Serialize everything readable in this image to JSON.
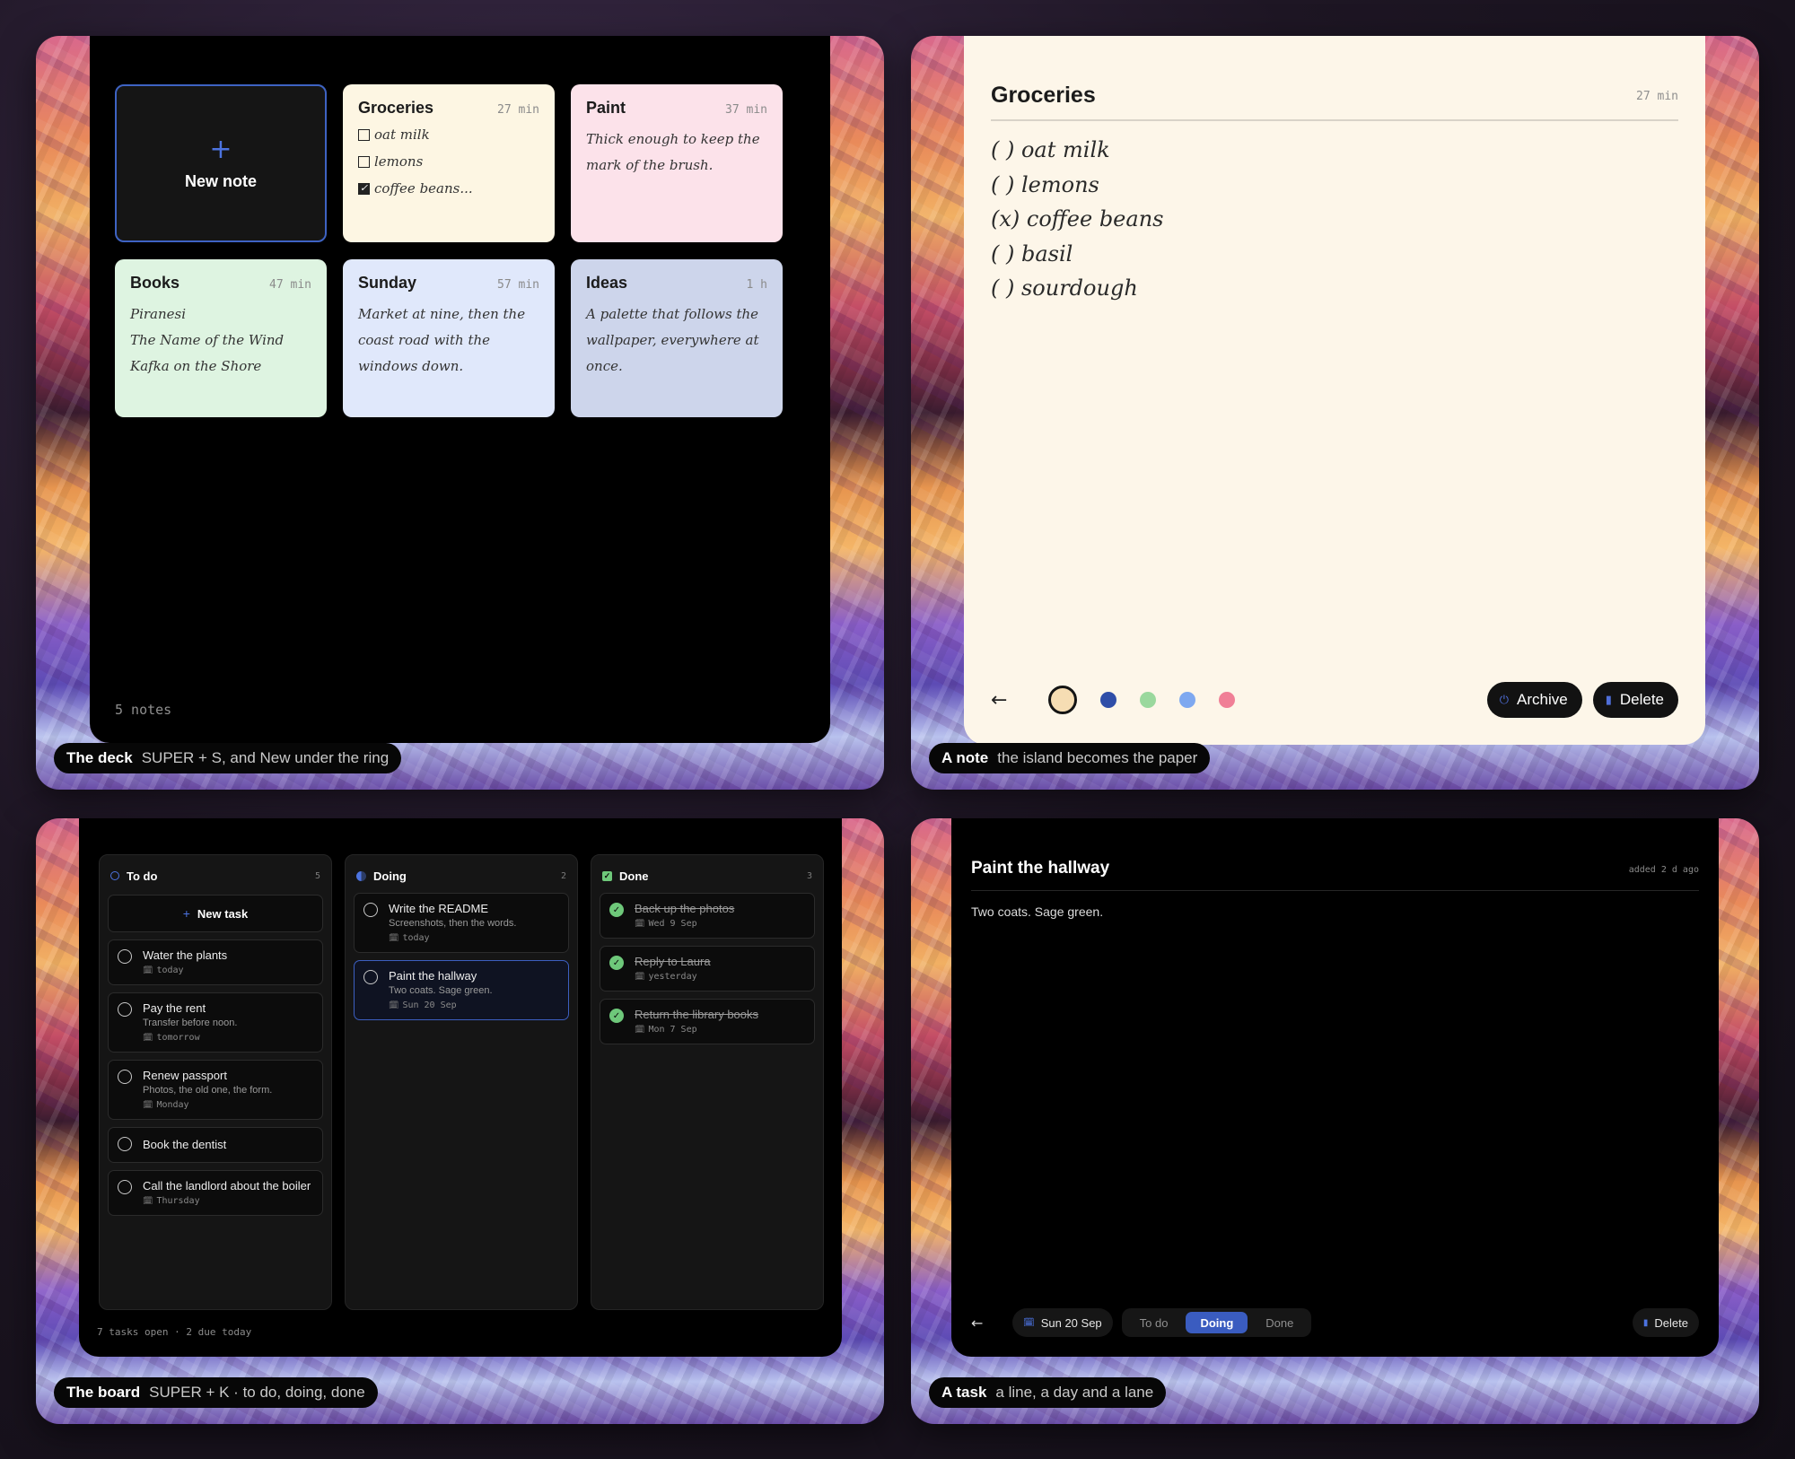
{
  "deck": {
    "caption_title": "The deck",
    "caption_text": "SUPER + S, and New under the ring",
    "new_note_icon": "+",
    "new_note_label": "New note",
    "count": "5 notes",
    "notes": {
      "groceries": {
        "title": "Groceries",
        "age": "27 min",
        "items": [
          {
            "text": "oat milk",
            "checked": false
          },
          {
            "text": "lemons",
            "checked": false
          },
          {
            "text": "coffee beans...",
            "checked": true
          }
        ],
        "color": "#fdf6e3"
      },
      "paint": {
        "title": "Paint",
        "age": "37 min",
        "lines": [
          "Thick enough to keep the",
          "mark of the brush."
        ],
        "color": "#fce2ea"
      },
      "books": {
        "title": "Books",
        "age": "47 min",
        "lines": [
          "Piranesi",
          "The Name of the Wind",
          "Kafka on the Shore"
        ],
        "color": "#def4e1"
      },
      "sunday": {
        "title": "Sunday",
        "age": "57 min",
        "lines": [
          "Market at nine, then the",
          "coast road with the",
          "windows down."
        ],
        "color": "#e0e8fb"
      },
      "ideas": {
        "title": "Ideas",
        "age": "1 h",
        "lines": [
          "A palette that follows the",
          "wallpaper, everywhere at",
          "once."
        ],
        "color": "#cdd5eb"
      }
    }
  },
  "note": {
    "caption_title": "A note",
    "caption_text": "the island becomes the paper",
    "title": "Groceries",
    "age": "27 min",
    "lines": [
      "( ) oat milk",
      "( ) lemons",
      "(x) coffee beans",
      "( ) basil",
      "( ) sourdough"
    ],
    "back_icon": "←",
    "swatches": [
      "#f6ddb3",
      "#2f4ea8",
      "#9ad89d",
      "#7ea8f0",
      "#f07f96"
    ],
    "archive_label": "Archive",
    "archive_icon": "⏻",
    "delete_label": "Delete",
    "delete_icon": "▮"
  },
  "board": {
    "caption_title": "The board",
    "caption_text": "SUPER + K · to do, doing, done",
    "footer": "7 tasks open · 2 due today",
    "new_task_label": "New task",
    "new_task_icon": "+",
    "calendar_icon": "🗓",
    "check_glyph": "✓",
    "columns": {
      "todo": {
        "title": "To do",
        "count": "5",
        "tasks": [
          {
            "title": "Water the plants",
            "due": "today"
          },
          {
            "title": "Pay the rent",
            "desc": "Transfer before noon.",
            "due": "tomorrow"
          },
          {
            "title": "Renew passport",
            "desc": "Photos, the old one, the form.",
            "due": "Monday"
          },
          {
            "title": "Book the dentist"
          },
          {
            "title": "Call the landlord about the boiler",
            "due": "Thursday"
          }
        ]
      },
      "doing": {
        "title": "Doing",
        "count": "2",
        "tasks": [
          {
            "title": "Write the README",
            "desc": "Screenshots, then the words.",
            "due": "today"
          },
          {
            "title": "Paint the hallway",
            "desc": "Two coats. Sage green.",
            "due": "Sun 20 Sep"
          }
        ]
      },
      "done": {
        "title": "Done",
        "count": "3",
        "tasks": [
          {
            "title": "Back up the photos",
            "due": "Wed 9 Sep"
          },
          {
            "title": "Reply to Laura",
            "due": "yesterday"
          },
          {
            "title": "Return the library books",
            "due": "Mon 7 Sep"
          }
        ]
      }
    }
  },
  "task": {
    "caption_title": "A task",
    "caption_text": "a line, a day and a lane",
    "title": "Paint the hallway",
    "added": "added 2 d ago",
    "body": "Two coats. Sage green.",
    "back_icon": "←",
    "date_chip": "Sun 20 Sep",
    "lanes": [
      "To do",
      "Doing",
      "Done"
    ],
    "active_lane": "Doing",
    "delete_label": "Delete"
  },
  "colors": {
    "accent": "#4c73e0",
    "done_green": "#6ec87a",
    "active_lane": "#3a5cc0"
  }
}
